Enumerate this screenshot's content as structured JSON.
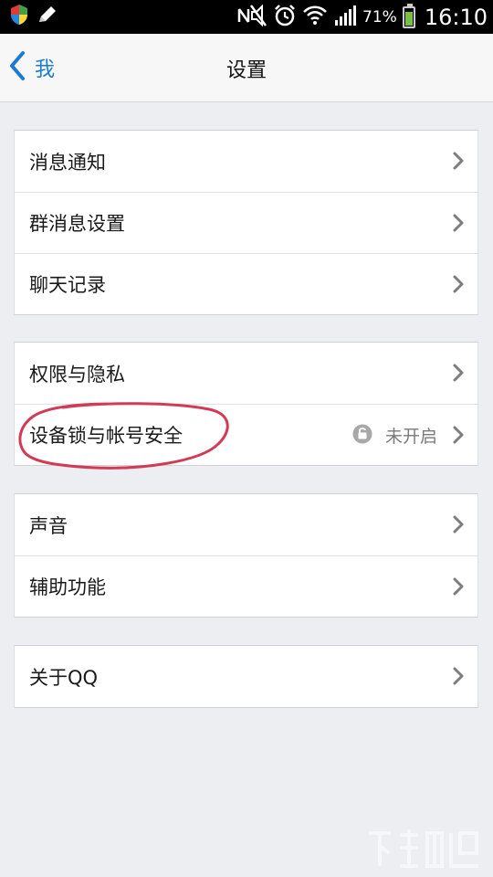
{
  "status_bar": {
    "battery_percent": "71%",
    "battery_level": 0.71,
    "time": "16:10",
    "icons": [
      "shield-icon",
      "edit-icon",
      "mute-icon",
      "alarm-icon",
      "wifi-icon",
      "signal-icon",
      "battery-icon"
    ]
  },
  "header": {
    "back_label": "我",
    "title": "设置",
    "accent": "#1a7bd1"
  },
  "groups": [
    {
      "items": [
        {
          "label": "消息通知"
        },
        {
          "label": "群消息设置"
        },
        {
          "label": "聊天记录"
        }
      ]
    },
    {
      "items": [
        {
          "label": "权限与隐私"
        },
        {
          "label": "设备锁与帐号安全",
          "value": "未开启",
          "icon": "lock-icon"
        }
      ]
    },
    {
      "items": [
        {
          "label": "声音"
        },
        {
          "label": "辅助功能"
        }
      ]
    },
    {
      "items": [
        {
          "label": "关于QQ"
        }
      ]
    }
  ],
  "annotation_color": "#d23a55"
}
